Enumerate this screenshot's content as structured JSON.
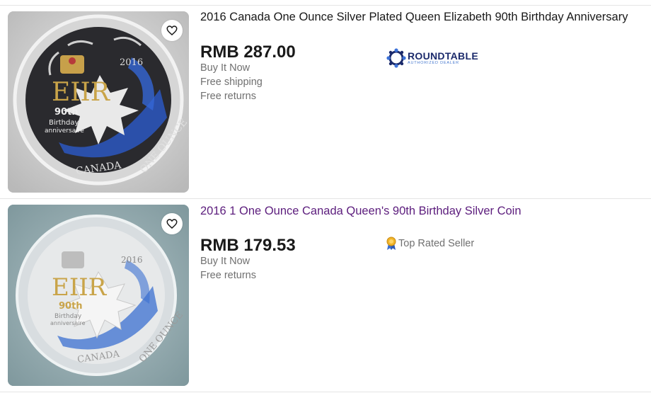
{
  "listings": [
    {
      "title": "2016 Canada One Ounce Silver Plated Queen Elizabeth 90th Birthday Anniversary",
      "price": "RMB 287.00",
      "buy_format": "Buy It Now",
      "shipping": "Free shipping",
      "returns": "Free returns",
      "seller_logo": {
        "name": "ROUNDTABLE",
        "tagline": "AUTHORIZED DEALER"
      },
      "title_color": "#191919",
      "coin": {
        "year": "2016",
        "monogram": "EIIR",
        "n90": "90th",
        "line1": "Birthday",
        "line2": "anniversaire",
        "bottom_left": "CANADA",
        "bottom_right": "ONE OUNCE"
      }
    },
    {
      "title": "2016 1 One Ounce Canada Queen's 90th Birthday Silver Coin",
      "price": "RMB 179.53",
      "buy_format": "Buy It Now",
      "returns": "Free returns",
      "badge": "Top Rated Seller",
      "title_color": "#5c1d7d",
      "coin": {
        "year": "2016",
        "monogram": "EIIR",
        "n90": "90th",
        "line1": "Birthday",
        "line2": "anniversaire",
        "bottom_left": "CANADA",
        "bottom_right": "ONE OUNCE"
      }
    }
  ],
  "icons": {
    "favorite": "heart-icon",
    "top_rated": "ribbon-award-icon"
  },
  "colors": {
    "accent_blue": "#1f4fa3",
    "logo_navy": "#1b2a6b"
  }
}
